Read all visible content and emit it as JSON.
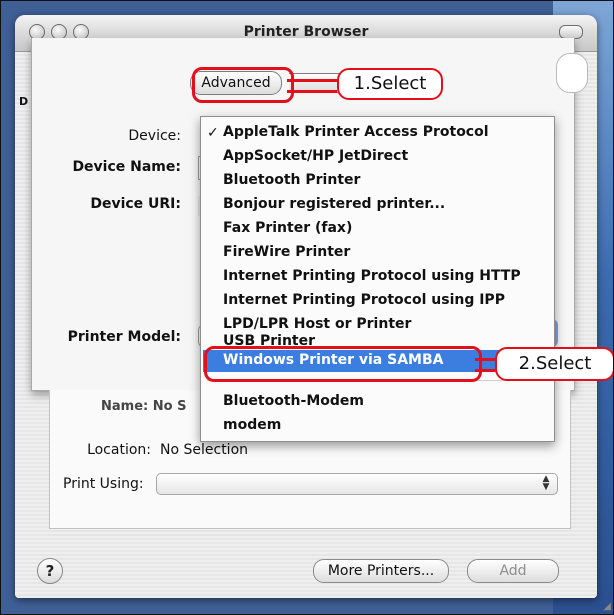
{
  "window": {
    "title": "Printer Browser"
  },
  "sheet": {
    "cut_label": "D",
    "advanced_button": "Advanced",
    "labels": {
      "device": "Device:",
      "device_name": "Device Name:",
      "device_uri": "Device URI:",
      "printer_model": "Printer Model:"
    }
  },
  "menu": {
    "checked_item": "AppleTalk Printer Access Protocol",
    "items": [
      "AppleTalk Printer Access Protocol",
      "AppSocket/HP JetDirect",
      "Bluetooth Printer",
      "Bonjour registered printer...",
      "Fax Printer (fax)",
      "FireWire Printer",
      "Internet Printing Protocol using HTTP",
      "Internet Printing Protocol using IPP",
      "LPD/LPR Host or Printer",
      "USB Printer",
      "Windows Printer via SAMBA",
      "Bluetooth-Modem",
      "modem"
    ],
    "selected_item": "Windows Printer via SAMBA"
  },
  "main": {
    "name_ghost": "Name: No S",
    "location_label": "Location:",
    "location_value": "No Selection",
    "print_using_label": "Print Using:",
    "help": "?",
    "more_printers": "More Printers...",
    "add": "Add"
  },
  "annotations": {
    "step1": "1.Select",
    "step2": "2.Select",
    "color": "#e3101b"
  },
  "colors": {
    "selection": "#3b7ee0"
  }
}
